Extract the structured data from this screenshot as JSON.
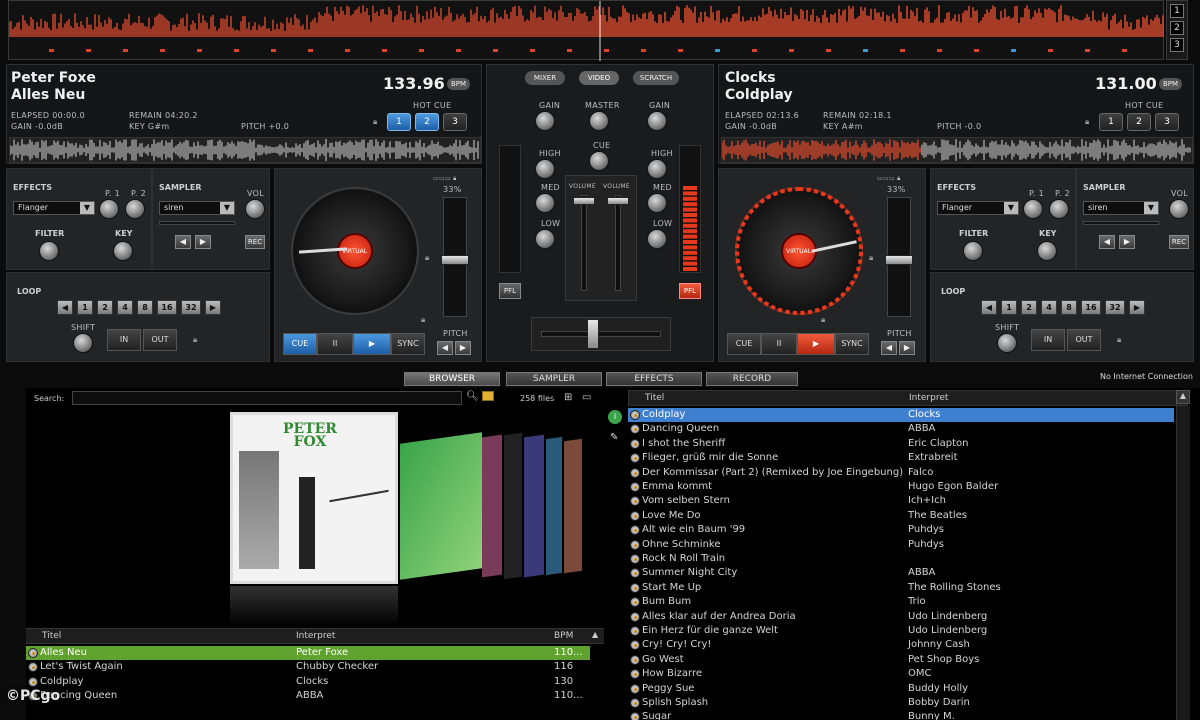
{
  "overview": {
    "zoom_buttons": [
      "1",
      "2",
      "3"
    ]
  },
  "deck_left": {
    "artist": "Peter Foxe",
    "title": "Alles Neu",
    "bpm": "133.96",
    "bpm_tag": "BPM",
    "elapsed": "ELAPSED 00:00.0",
    "remain": "REMAIN 04:20.2",
    "gain": "GAIN -0.0dB",
    "key": "KEY G#m",
    "pitch": "PITCH +0.0",
    "hot_cue_label": "HOT CUE",
    "hot_cues": [
      "1",
      "2",
      "3"
    ],
    "effects_label": "EFFECTS",
    "effect_select": "Flanger",
    "p1": "P. 1",
    "p2": "P. 2",
    "filter_label": "FILTER",
    "key_label": "KEY",
    "sampler_label": "SAMPLER",
    "sampler_select": "siren",
    "vol_label": "VOL",
    "rec_label": "REC",
    "loop_label": "LOOP",
    "loop_values": [
      "1",
      "2",
      "4",
      "8",
      "16",
      "32"
    ],
    "shift_label": "SHIFT",
    "in_label": "IN",
    "out_label": "OUT",
    "platter_label": "VIRTUAL",
    "cue": "CUE",
    "pause": "II",
    "play": "▶",
    "sync": "SYNC",
    "pitch_label": "PITCH",
    "pitch_pct": "33%"
  },
  "deck_right": {
    "artist": "Clocks",
    "title": "Coldplay",
    "bpm": "131.00",
    "bpm_tag": "BPM",
    "elapsed": "ELAPSED 02:13.6",
    "remain": "REMAIN 02:18.1",
    "gain": "GAIN -0.0dB",
    "key": "KEY A#m",
    "pitch": "PITCH -0.0",
    "hot_cue_label": "HOT CUE",
    "hot_cues": [
      "1",
      "2",
      "3"
    ],
    "effects_label": "EFFECTS",
    "effect_select": "Flanger",
    "p1": "P. 1",
    "p2": "P. 2",
    "filter_label": "FILTER",
    "key_label": "KEY",
    "sampler_label": "SAMPLER",
    "sampler_select": "siren",
    "vol_label": "VOL",
    "rec_label": "REC",
    "loop_label": "LOOP",
    "loop_values": [
      "1",
      "2",
      "4",
      "8",
      "16",
      "32"
    ],
    "shift_label": "SHIFT",
    "in_label": "IN",
    "out_label": "OUT",
    "platter_label": "VIRTUAL",
    "cue": "CUE",
    "pause": "II",
    "play": "▶",
    "sync": "SYNC",
    "pitch_label": "PITCH",
    "pitch_pct": "33%"
  },
  "mixer": {
    "tabs": [
      "MIXER",
      "VIDEO",
      "SCRATCH"
    ],
    "gain": "GAIN",
    "master": "MASTER",
    "cue": "CUE",
    "high": "HIGH",
    "med": "MED",
    "low": "LOW",
    "volume": "VOLUME",
    "pfl": "PFL"
  },
  "browser_tabs": [
    "BROWSER",
    "SAMPLER",
    "EFFECTS",
    "RECORD"
  ],
  "internet_status": "No Internet Connection",
  "search": {
    "label": "Search:",
    "value": "",
    "file_count": "258 files"
  },
  "album_art": {
    "line1": "PETER",
    "line2": "FOX"
  },
  "left_list": {
    "headers": [
      "Titel",
      "Interpret",
      "BPM"
    ],
    "rows": [
      {
        "title": "Alles Neu",
        "artist": "Peter Foxe",
        "bpm": "110..."
      },
      {
        "title": "Let's Twist Again",
        "artist": "Chubby Checker",
        "bpm": "116"
      },
      {
        "title": "Coldplay",
        "artist": "Clocks",
        "bpm": "130"
      },
      {
        "title": "Dancing Queen",
        "artist": "ABBA",
        "bpm": "110..."
      }
    ]
  },
  "right_list": {
    "headers": [
      "Titel",
      "Interpret"
    ],
    "rows": [
      {
        "title": "Coldplay",
        "artist": "Clocks"
      },
      {
        "title": "Dancing Queen",
        "artist": "ABBA"
      },
      {
        "title": "I shot the Sheriff",
        "artist": "Eric Clapton"
      },
      {
        "title": "Flieger, grüß mir die Sonne",
        "artist": "Extrabreit"
      },
      {
        "title": "Der Kommissar (Part 2) (Remixed by Joe Eingebung)",
        "artist": "Falco"
      },
      {
        "title": "Emma kommt",
        "artist": "Hugo Egon Balder"
      },
      {
        "title": "Vom selben Stern",
        "artist": "Ich+Ich"
      },
      {
        "title": "Love Me Do",
        "artist": "The Beatles"
      },
      {
        "title": "Alt wie ein Baum '99",
        "artist": "Puhdys"
      },
      {
        "title": "Ohne Schminke",
        "artist": "Puhdys"
      },
      {
        "title": "Rock N Roll Train",
        "artist": ""
      },
      {
        "title": "Summer Night City",
        "artist": "ABBA"
      },
      {
        "title": "Start Me Up",
        "artist": "The Rolling Stones"
      },
      {
        "title": "Bum Bum",
        "artist": "Trio"
      },
      {
        "title": "Alles klar auf der Andrea Doria",
        "artist": "Udo Lindenberg"
      },
      {
        "title": "Ein Herz für die ganze Welt",
        "artist": "Udo Lindenberg"
      },
      {
        "title": "Cry! Cry! Cry!",
        "artist": "Johnny Cash"
      },
      {
        "title": "Go West",
        "artist": "Pet Shop Boys"
      },
      {
        "title": "How Bizarre",
        "artist": "OMC"
      },
      {
        "title": "Peggy Sue",
        "artist": "Buddy Holly"
      },
      {
        "title": "Splish Splash",
        "artist": "Bobby Darin"
      },
      {
        "title": "Sugar",
        "artist": "Bunny M."
      }
    ]
  },
  "watermark": "©PCgo",
  "colors": {
    "accent_blue": "#3d8fdc",
    "accent_red": "#e8381c",
    "accent_green": "#5fa32e",
    "selected_row": "#3f7fcf"
  }
}
